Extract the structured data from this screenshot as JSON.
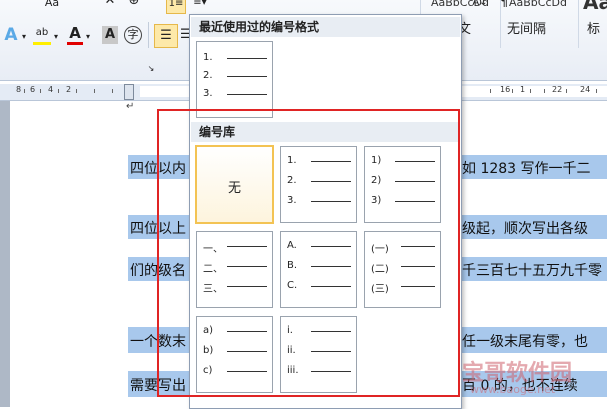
{
  "ribbon": {
    "font_color_glyph": "A",
    "highlight_glyph": "ab",
    "char_shading_glyph": "A",
    "char_border_glyph": "字",
    "style_samples": [
      "AaBbCcDd",
      "AaBbCcDd",
      "Aa"
    ],
    "style_names": [
      "正文",
      "无间隔",
      "标"
    ],
    "style_bullet": "↵"
  },
  "dropdown": {
    "recent_header": "最近使用过的编号格式",
    "recent_items": [
      "1.",
      "2.",
      "3."
    ],
    "library_header": "编号库",
    "none_label": "无",
    "lib_1": [
      "1.",
      "2.",
      "3."
    ],
    "lib_2": [
      "1)",
      "2)",
      "3)"
    ],
    "lib_3": [
      "一、",
      "二、",
      "三、"
    ],
    "lib_4": [
      "A.",
      "B.",
      "C."
    ],
    "lib_5": [
      "(一)",
      "(二)",
      "(三)"
    ],
    "lib_6": [
      "a)",
      "b)",
      "c)"
    ],
    "lib_7": [
      "i.",
      "ii.",
      "iii."
    ]
  },
  "document": {
    "line1_left": "四位以内",
    "line1_right": "如  1283 写作一千二",
    "line2_left": "四位以上",
    "line2_right": "级起，顺次写出各级",
    "line3_left": "们的级名",
    "line3_right": "千三百七十五万九千零",
    "line4_left": "一个数末",
    "line4_right": "任一级末尾有零，也",
    "line5_left": "需要写出",
    "line5_right": "百 0 的，也不连续"
  },
  "watermark": {
    "main": "宝哥软件园",
    "sub": "www.baoge.net"
  },
  "colors": {
    "selection_highlight": "#a8c8ec",
    "annotation_red": "#e02424",
    "selected_tile": "#f3c353"
  }
}
